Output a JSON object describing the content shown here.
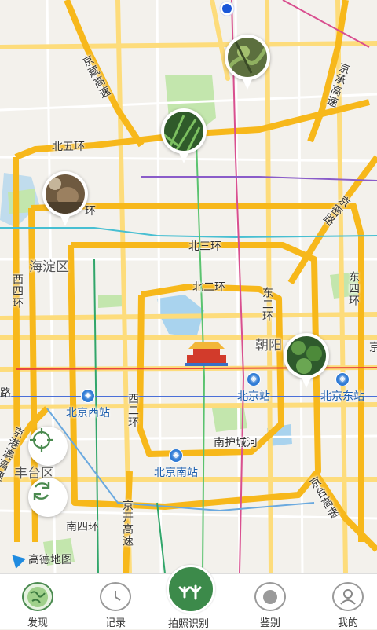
{
  "map": {
    "areas": {
      "haidian": "海淀区",
      "fengtai": "丰台区",
      "chaoyang": "朝阳"
    },
    "roads": {
      "jingzang": "京藏高速",
      "jingcheng": "京承高速",
      "beiwuhuan": "北五环",
      "sihuan_frag": "环",
      "beisanhuan": "北三环",
      "beierhuan": "北二环",
      "xisihuan": "西四环",
      "xierhuan": "西二环",
      "dongerhuan": "东二环",
      "dongsihuan": "东四环",
      "jingmi": "京密路",
      "nanhucheng": "南护城河",
      "nansihuan": "南四环",
      "jingkai": "京开高速",
      "jingtai": "京台高速",
      "jinggang": "京港澳高速",
      "lu_frag": "路",
      "jing_frag": "京"
    },
    "stations": {
      "beijing": "北京站",
      "beijingxi": "北京西站",
      "beijingdong": "北京东站",
      "beijingnan": "北京南站"
    },
    "logo": "高德地图",
    "colors": {
      "ring": "#f7b81b",
      "road": "#fddc7b",
      "green": "#bfe3a8",
      "water": "#a9d3ee",
      "user": "#1a57d8"
    }
  },
  "tabs": [
    {
      "label": "发现",
      "icon": "globe-icon"
    },
    {
      "label": "记录",
      "icon": "clock-icon"
    },
    {
      "label": "拍照识别",
      "icon": "plant-sprout-icon"
    },
    {
      "label": "鉴别",
      "icon": "target-circle-icon"
    },
    {
      "label": "我的",
      "icon": "user-icon"
    }
  ]
}
